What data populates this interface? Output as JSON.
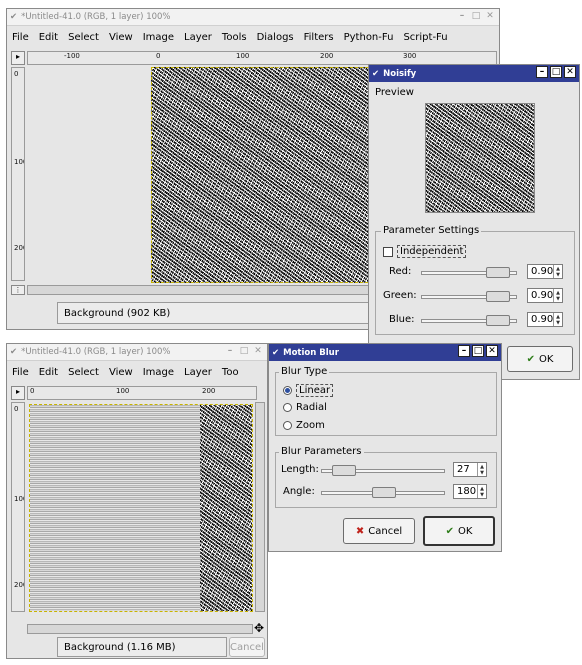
{
  "top_image_window": {
    "title": "*Untitled-41.0 (RGB, 1 layer) 100%",
    "menu": [
      "File",
      "Edit",
      "Select",
      "View",
      "Image",
      "Layer",
      "Tools",
      "Dialogs",
      "Filters",
      "Python-Fu",
      "Script-Fu"
    ],
    "ruler_h": [
      "-100",
      "0",
      "100",
      "200",
      "300"
    ],
    "ruler_v": [
      "0",
      "100",
      "200"
    ],
    "status": "Background (902 KB)"
  },
  "noisify": {
    "title": "Noisify",
    "preview_label": "Preview",
    "params_title": "Parameter Settings",
    "independent_label": "Independent",
    "independent_checked": false,
    "channels": [
      {
        "label": "Red:",
        "value": "0.90",
        "level": 0.9
      },
      {
        "label": "Green:",
        "value": "0.90",
        "level": 0.9
      },
      {
        "label": "Blue:",
        "value": "0.90",
        "level": 0.9
      }
    ],
    "ok_label": "OK"
  },
  "bottom_image_window": {
    "title": "*Untitled-41.0 (RGB, 1 layer) 100%",
    "menu": [
      "File",
      "Edit",
      "Select",
      "View",
      "Image",
      "Layer",
      "Too"
    ],
    "ruler_h": [
      "0",
      "100",
      "200"
    ],
    "ruler_v": [
      "0",
      "100",
      "200"
    ],
    "status": "Background (1.16 MB)",
    "cancel_label": "Cancel"
  },
  "motion_blur": {
    "title": "Motion Blur",
    "blur_type_title": "Blur Type",
    "types": [
      {
        "label": "Linear",
        "selected": true
      },
      {
        "label": "Radial",
        "selected": false
      },
      {
        "label": "Zoom",
        "selected": false
      }
    ],
    "params_title": "Blur Parameters",
    "length_label": "Length:",
    "length_value": "27",
    "length_level": 0.1,
    "angle_label": "Angle:",
    "angle_value": "180",
    "angle_level": 0.5,
    "cancel_label": "Cancel",
    "ok_label": "OK"
  }
}
